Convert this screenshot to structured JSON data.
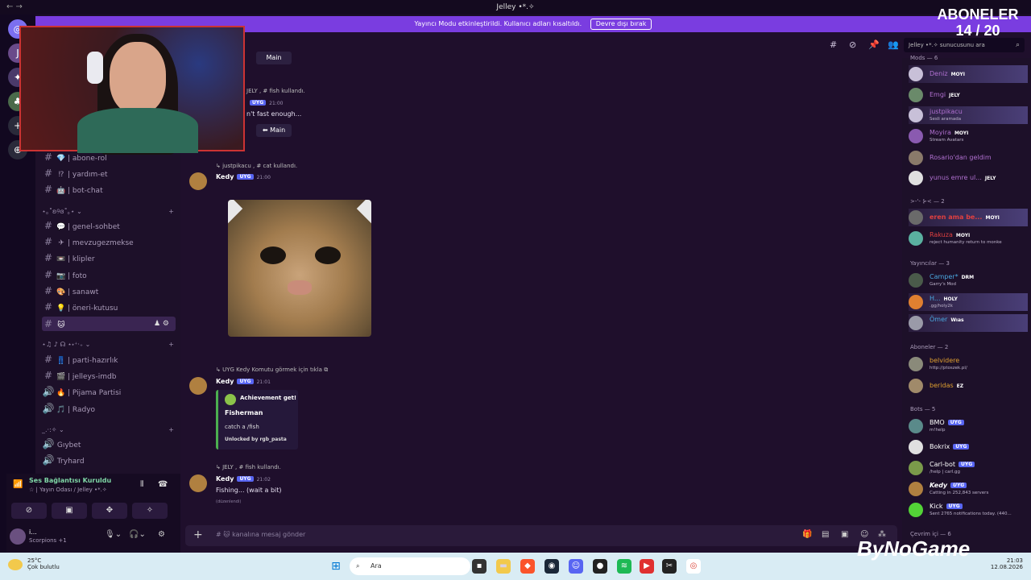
{
  "window": {
    "title": "Jelley •*.✧",
    "nav": "←  →"
  },
  "streamer_mode": {
    "text": "Yayıncı Modu etkinleştirildi. Kullanıcı adları kısaltıldı.",
    "button": "Devre dışı bırak"
  },
  "subs_overlay": {
    "label": "ABONELER",
    "count": "14 / 20"
  },
  "channels": [
    {
      "emoji": "💎",
      "name": "abone-rol"
    },
    {
      "emoji": "⁉",
      "name": "yardım-et"
    },
    {
      "emoji": "🤖",
      "name": "bot-chat"
    },
    {
      "emoji": "💬",
      "name": "genel-sohbet"
    },
    {
      "emoji": "✈",
      "name": "mevzugezmekse"
    },
    {
      "emoji": "📼",
      "name": "klipler"
    },
    {
      "emoji": "📷",
      "name": "foto"
    },
    {
      "emoji": "🎨",
      "name": "sanawt"
    },
    {
      "emoji": "💡",
      "name": "öneri-kutusu"
    },
    {
      "emoji": "🐱",
      "name": ""
    }
  ],
  "categories": {
    "cat1": "⋆｡˚ʚ୨ɞ˚｡⋆",
    "cat2": "⋆♫ ♪ ☊ ⋆˖⁺‧₊",
    "cat3": "_.·:✧"
  },
  "channels2": [
    {
      "emoji": "👖",
      "name": "parti-hazırlık"
    },
    {
      "emoji": "🎬",
      "name": "jelleys-imdb"
    },
    {
      "emoji": "🔥",
      "name": "Pijama Partisi"
    },
    {
      "emoji": "🎵",
      "name": "Radyo"
    }
  ],
  "channels3": [
    {
      "name": "Gıybet"
    },
    {
      "name": "Tryhard"
    }
  ],
  "voice": {
    "status": "Ses Bağlantısı Kuruldu",
    "sub": "☆ | Yayın Odası / Jelley •*.✧"
  },
  "user": {
    "name": "i...",
    "status": "Scorpions +1"
  },
  "chat": {
    "msg0_main": "Main",
    "msg1_reply_users": "JELY , # fish kullandı.",
    "msg1_author": "Kedy",
    "msg1_tag": "UYG",
    "msg1_time": "21:00",
    "msg1_text": "n't fast enough...",
    "msg1_button": "Main",
    "msg2_reply": "justpikacu , # cat kullandı.",
    "msg2_author": "Kedy",
    "msg2_tag": "UYG",
    "msg2_time": "21:00",
    "msg3_reply": "UYG Kedy Komutu görmek için tıkla",
    "msg3_author": "Kedy",
    "msg3_tag": "UYG",
    "msg3_time": "21:01",
    "embed_title": "Achievement get!",
    "embed_name": "Fisherman",
    "embed_desc": "catch a /fish",
    "embed_unlock": "Unlocked by rgb_pasta",
    "msg4_reply": "JELY , # fish kullandı.",
    "msg4_author": "Kedy",
    "msg4_tag": "UYG",
    "msg4_time": "21:02",
    "msg4_text": "Fishing... (wait a bit)",
    "msg4_edited": "(düzenlendi)"
  },
  "composer": {
    "placeholder": "# 🐱 kanalına mesaj gönder"
  },
  "search": {
    "placeholder": "Jelley •*.✧ sunucusunu ara"
  },
  "members": {
    "mods_header": "Mods — 6",
    "mods": [
      {
        "name": "Deniz",
        "badge": "MOYI",
        "activity": "",
        "color": "#b070d0"
      },
      {
        "name": "Emgi",
        "badge": "JELY",
        "activity": "",
        "color": "#b070d0"
      },
      {
        "name": "justpikacu",
        "badge": "",
        "activity": "Sesli aramada",
        "color": "#b070d0"
      },
      {
        "name": "Moyira",
        "badge": "MOYI",
        "activity": "Stream Avatars",
        "color": "#b070d0"
      },
      {
        "name": "Rosario'dan geldim",
        "badge": "",
        "activity": "",
        "color": "#b070d0"
      },
      {
        "name": "yunus emre ul...",
        "badge": "JELY",
        "activity": "",
        "color": "#b070d0"
      }
    ],
    "g2_header": ">-'- ⊱< — 2",
    "g2": [
      {
        "name": "eren ama be...",
        "badge": "MOYI",
        "activity": "",
        "color": "#e04040"
      },
      {
        "name": "Rakuza",
        "badge": "MOYI",
        "activity": "reject humanity return to monke",
        "color": "#e04040"
      }
    ],
    "yay_header": "Yayıncılar — 3",
    "yay": [
      {
        "name": "Camper*",
        "badge": "DRM",
        "activity": "Garry's Mod",
        "color": "#4aa8e0"
      },
      {
        "name": "H...",
        "badge": "HOLY",
        "activity": ".gg/holy2k",
        "color": "#4aa8e0"
      },
      {
        "name": "Ömer",
        "badge": "Wıas",
        "activity": "",
        "color": "#4aa8e0"
      }
    ],
    "abo_header": "Aboneler — 2",
    "abo": [
      {
        "name": "belvidere",
        "badge": "",
        "activity": "http://ptoszek.pl/",
        "color": "#e0a030"
      },
      {
        "name": "beridas",
        "badge": "EZ",
        "activity": "",
        "color": "#e0a030"
      }
    ],
    "bots_header": "Bots — 5",
    "bots": [
      {
        "name": "BMO",
        "badge": "UYG",
        "activity": "m!help",
        "color": "#ffffff"
      },
      {
        "name": "Bokrix",
        "badge": "UYG",
        "activity": "",
        "color": "#ffffff"
      },
      {
        "name": "Carl-bot",
        "badge": "UYG",
        "activity": "/help | carl.gg",
        "color": "#ffffff"
      },
      {
        "name": "Kedy",
        "badge": "UYG",
        "activity": "Catting in 252,843 servers",
        "color": "#ffffff"
      },
      {
        "name": "Kick",
        "badge": "UYG",
        "activity": "Sent 2765 notifications today. (440...",
        "color": "#ffffff"
      }
    ],
    "online_header": "Çevrim içi — 6"
  },
  "taskbar": {
    "temp": "25°C",
    "weather": "Çok bulutlu",
    "search": "Ara",
    "time": "21:03",
    "date": "12.08.2026"
  },
  "watermark": "ByNoGame"
}
